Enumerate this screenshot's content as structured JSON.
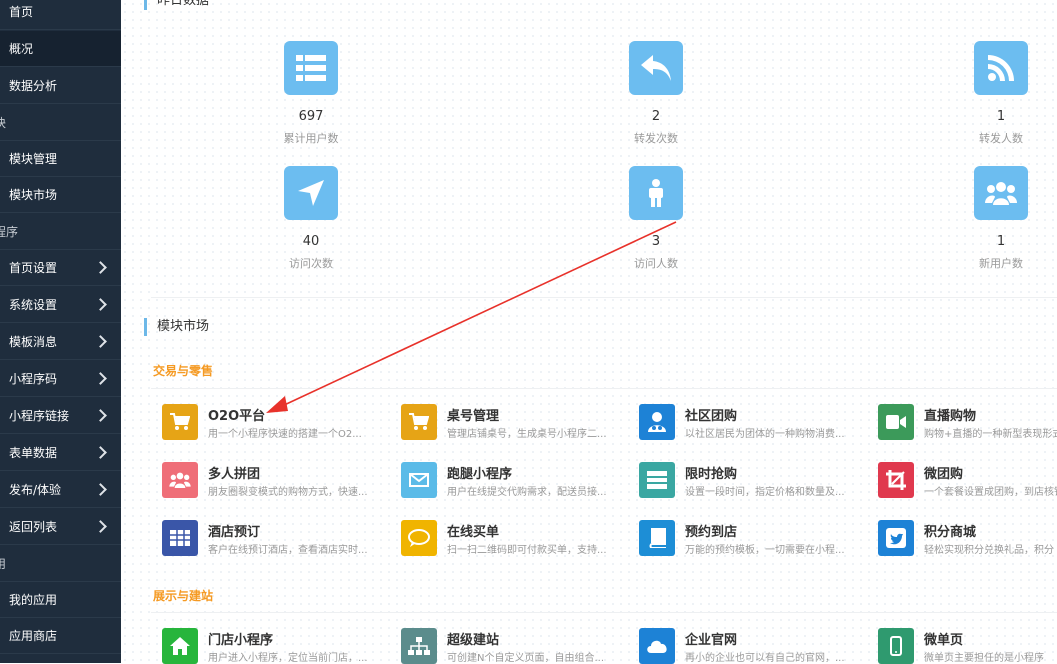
{
  "sidebar": {
    "items": [
      {
        "label": "首页",
        "type": "item"
      },
      {
        "label": "概况",
        "type": "item",
        "active": true
      },
      {
        "label": "数据分析",
        "type": "item"
      },
      {
        "label": "块",
        "type": "section"
      },
      {
        "label": "模块管理",
        "type": "item"
      },
      {
        "label": "模块市场",
        "type": "item"
      },
      {
        "label": "程序",
        "type": "section"
      },
      {
        "label": "首页设置",
        "type": "item",
        "arrow": true
      },
      {
        "label": "系统设置",
        "type": "item",
        "arrow": true
      },
      {
        "label": "模板消息",
        "type": "item",
        "arrow": true
      },
      {
        "label": "小程序码",
        "type": "item",
        "arrow": true
      },
      {
        "label": "小程序链接",
        "type": "item",
        "arrow": true
      },
      {
        "label": "表单数据",
        "type": "item",
        "arrow": true
      },
      {
        "label": "发布/体验",
        "type": "item",
        "arrow": true
      },
      {
        "label": "返回列表",
        "type": "item",
        "arrow": true
      },
      {
        "label": "用",
        "type": "section"
      },
      {
        "label": "我的应用",
        "type": "item"
      },
      {
        "label": "应用商店",
        "type": "item"
      }
    ]
  },
  "yesterday": {
    "title": "昨日数据",
    "stats": [
      {
        "value": "697",
        "label": "累计用户数",
        "icon": "list-icon"
      },
      {
        "value": "2",
        "label": "转发次数",
        "icon": "reply-icon"
      },
      {
        "value": "1",
        "label": "转发人数",
        "icon": "rss-icon"
      },
      {
        "value": "40",
        "label": "访问次数",
        "icon": "location-arrow-icon"
      },
      {
        "value": "3",
        "label": "访问人数",
        "icon": "person-icon"
      },
      {
        "value": "1",
        "label": "新用户数",
        "icon": "users-icon"
      }
    ]
  },
  "market": {
    "title": "模块市场",
    "groups": [
      {
        "title": "交易与零售",
        "modules": [
          {
            "name": "O2O平台",
            "desc": "用一个小程序快速的搭建一个O2...",
            "icon": "cart-icon",
            "color": "#e6a416"
          },
          {
            "name": "桌号管理",
            "desc": "管理店铺桌号，生成桌号小程序二...",
            "icon": "cart-icon",
            "color": "#e6a416"
          },
          {
            "name": "社区团购",
            "desc": "以社区居民为团体的一种购物消费...",
            "icon": "group-buy-icon",
            "color": "#1d82d6"
          },
          {
            "name": "直播购物",
            "desc": "购物+直播的一种新型表现形式",
            "icon": "video-icon",
            "color": "#3c9a5a"
          },
          {
            "name": "多人拼团",
            "desc": "朋友圈裂变模式的购物方式，快速...",
            "icon": "users-icon",
            "color": "#ef6e78"
          },
          {
            "name": "跑腿小程序",
            "desc": "用户在线提交代购需求，配送员接...",
            "icon": "envelope-icon",
            "color": "#5bbbe8"
          },
          {
            "name": "限时抢购",
            "desc": "设置一段时间，指定价格和数量及...",
            "icon": "server-icon",
            "color": "#3aa7a2"
          },
          {
            "name": "微团购",
            "desc": "一个套餐设置成团购，到店核销",
            "icon": "crop-icon",
            "color": "#e0394e"
          },
          {
            "name": "酒店预订",
            "desc": "客户在线预订酒店，查看酒店实时...",
            "icon": "table-icon",
            "color": "#3a56a8"
          },
          {
            "name": "在线买单",
            "desc": "扫一扫二维码即可付款买单，支持...",
            "icon": "comment-icon",
            "color": "#f0b400"
          },
          {
            "name": "预约到店",
            "desc": "万能的预约模板，一切需要在小程...",
            "icon": "book-icon",
            "color": "#1d8ed6"
          },
          {
            "name": "积分商城",
            "desc": "轻松实现积分兑换礼品，积分",
            "icon": "twitter-icon",
            "color": "#1d82d6"
          }
        ]
      },
      {
        "title": "展示与建站",
        "modules": [
          {
            "name": "门店小程序",
            "desc": "用户进入小程序，定位当前门店，...",
            "icon": "home-icon",
            "color": "#27b53c"
          },
          {
            "name": "超级建站",
            "desc": "可创建N个自定义页面，自由组合...",
            "icon": "sitemap-icon",
            "color": "#5b8c8c"
          },
          {
            "name": "企业官网",
            "desc": "再小的企业也可以有自己的官网，...",
            "icon": "cloud-icon",
            "color": "#1d82d6"
          },
          {
            "name": "微单页",
            "desc": "微单页主要担任的是小程序",
            "icon": "mobile-icon",
            "color": "#2f9a6f"
          }
        ]
      }
    ]
  }
}
